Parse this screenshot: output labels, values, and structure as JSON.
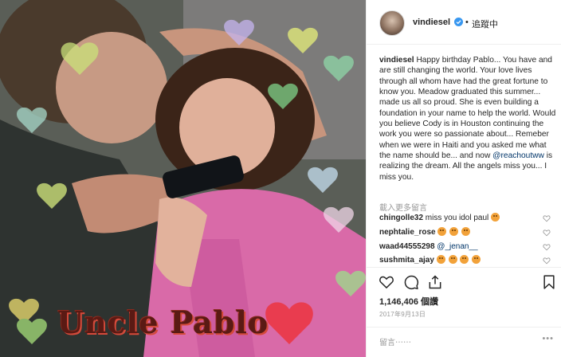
{
  "photo": {
    "overlay_text": "Uncle Pablo",
    "colors": {
      "pink_dress": "#d96aa8",
      "shirt": "#2e3330",
      "hearts": "#e93c4f"
    }
  },
  "post": {
    "username": "vindiesel",
    "separator": "•",
    "follow_status": "追蹤中",
    "caption_user": "vindiesel",
    "caption_text_1": "Happy birthday Pablo... You have and are still changing the world. Your love lives through all whom have had the great fortune to know you. Meadow graduated this summer... made us all so proud. She is even building a foundation in your name to help the world. Would you believe Cody is in Houston continuing the work you were so passionate about... Remeber when we were in Haiti and you asked me what the name should be... and now ",
    "caption_mention": "@reachoutww",
    "caption_text_2": " is realizing the dream. All the angels miss you... I miss you.",
    "view_all_comments": "載入更多留言",
    "comments": [
      {
        "user": "chingolle32",
        "text": "miss you idol paul",
        "emoji_count": 1
      },
      {
        "user": "nephtalie_rose",
        "text": "",
        "emoji_count": 3
      },
      {
        "user": "waad44555298",
        "text": "@_jenan__",
        "emoji_count": 0
      },
      {
        "user": "sushmita_ajay",
        "text": "",
        "emoji_count": 4
      }
    ],
    "likes": "1,146,406 個讚",
    "date": "2017年9月13日",
    "comment_placeholder": "留言⋯⋯",
    "more_options": "•••",
    "icons": [
      "heart-icon",
      "comment-icon",
      "share-icon",
      "bookmark-icon",
      "verified-badge-icon"
    ],
    "accent_color": "#3897f0",
    "mention_color": "#003569"
  }
}
